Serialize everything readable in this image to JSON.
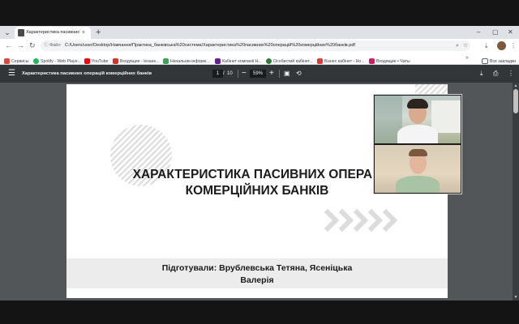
{
  "browser": {
    "tab_title": "Характеристика пасивних опе",
    "tab_close": "×",
    "new_tab": "+",
    "window_controls": [
      "–",
      "▢",
      "✕"
    ],
    "address": {
      "file_chip": "Файл",
      "url": "C:/Users/user/Desktop/Навчання/Практика_банківська%20система/Характеристика%20пасивних%20операцій%20комерційних%20банків.pdf"
    },
    "bookmarks": [
      {
        "label": "Сервисы",
        "icon_color": "#ea4335"
      },
      {
        "label": "Spotify - Web Playe...",
        "icon_color": "#1db954"
      },
      {
        "label": "YouTube",
        "icon_color": "#ff0000"
      },
      {
        "label": "Входящие - lesase...",
        "icon_color": "#d93025"
      },
      {
        "label": "Начальню-інформ...",
        "icon_color": "#34a853"
      },
      {
        "label": "Кабінет компанії Н...",
        "icon_color": "#6a1b9a"
      },
      {
        "label": "Особистий кабінет...",
        "icon_color": "#2e7d32"
      },
      {
        "label": "Бізнес кабінет - Но...",
        "icon_color": "#e53935"
      },
      {
        "label": "Входящие • Чаты",
        "icon_color": "#d81b60"
      }
    ],
    "bookmarks_more": "»",
    "all_bookmarks": "Все закладки"
  },
  "pdf": {
    "title": "Характеристика пасивних операцій комерційних банків",
    "current_page": "1",
    "page_sep": "/",
    "total_pages": "10",
    "zoom": "59%",
    "zoom_minus": "−",
    "zoom_plus": "+"
  },
  "slide": {
    "title_line1": "ХАРАКТЕРИСТИКА ПАСИВНИХ ОПЕРАЦ",
    "title_line2": "КОМЕРЦІЙНИХ БАНКІВ",
    "prepared_line1": "Підготували: Врублевська Тетяна,  Ясеніцька",
    "prepared_line2": "Валерія"
  },
  "colors": {
    "pdf_toolbar": "#323639",
    "viewer_bg": "#525659",
    "chrome_bg": "#dee1e6",
    "slide_band": "#ececec"
  }
}
